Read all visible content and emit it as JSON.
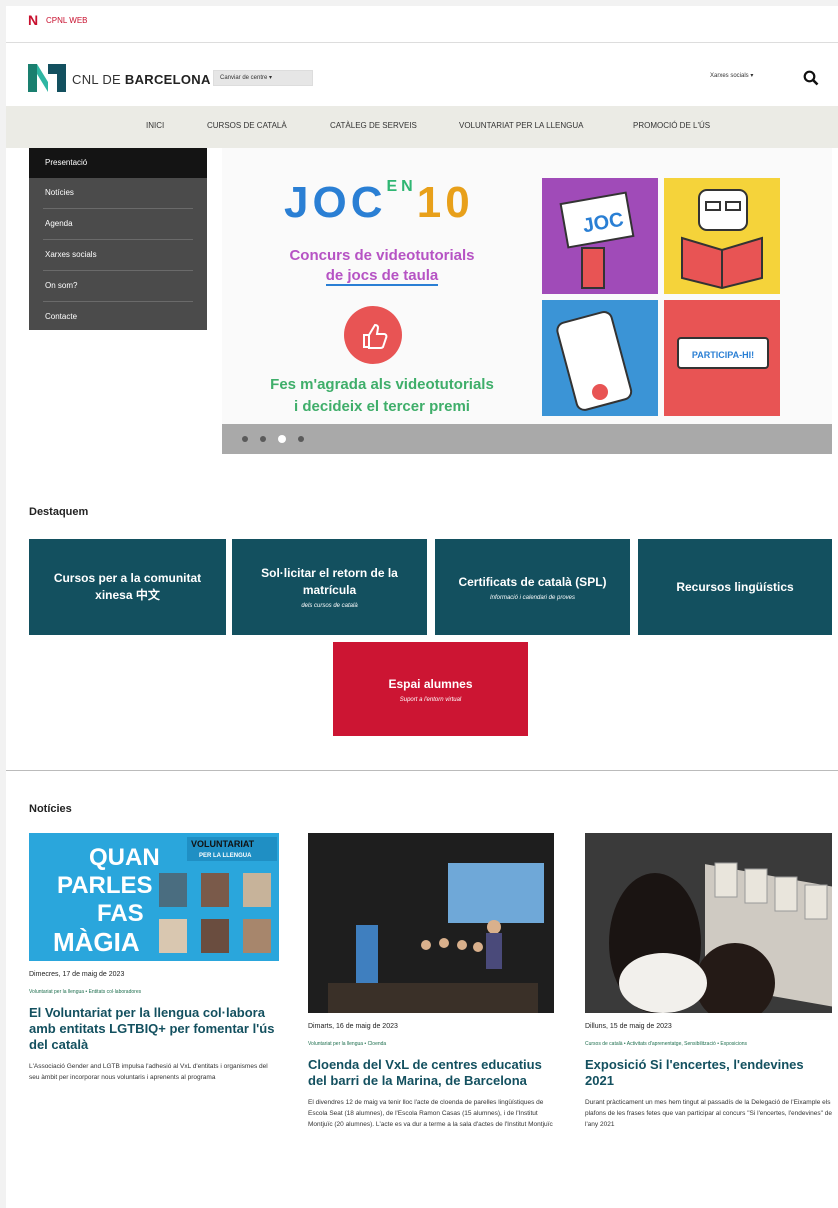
{
  "topbar": {
    "brand": "CPNL WEB"
  },
  "header": {
    "brand_prefix": "CNL DE ",
    "brand_city": "BARCELONA",
    "center_select": "Canviar de centre",
    "social_select": "Xarxes socials"
  },
  "nav": {
    "items": [
      "INICI",
      "CURSOS DE CATALÀ",
      "CATÀLEG DE SERVEIS",
      "VOLUNTARIAT PER LA LLENGUA",
      "PROMOCIÓ DE L'ÚS"
    ]
  },
  "sidemenu": {
    "items": [
      "Presentació",
      "Notícies",
      "Agenda",
      "Xarxes socials",
      "On som?",
      "Contacte"
    ]
  },
  "slider": {
    "title_left": "JOC",
    "title_en": "EN",
    "title_right": "10",
    "subtitle_line1": "Concurs de videotutorials",
    "subtitle_line2": "de jocs de taula",
    "cta_line1": "Fes m'agrada als videotutorials",
    "cta_line2": "i decideix el tercer premi",
    "tile_joc": "JOC",
    "tile_participa": "PARTICIPA-HI!",
    "active_dot": 2
  },
  "destaquem": {
    "title": "Destaquem",
    "cards": [
      {
        "title": "Cursos per a la comunitat xinesa 中文",
        "subtitle": ""
      },
      {
        "title": "Sol·licitar el retorn de la matrícula",
        "subtitle": "dels cursos de català"
      },
      {
        "title": "Certificats de català (SPL)",
        "subtitle": "Informació i calendari de proves"
      },
      {
        "title": "Recursos lingüístics",
        "subtitle": ""
      },
      {
        "title": "Espai alumnes",
        "subtitle": "Suport a l'entorn virtual"
      }
    ]
  },
  "noticies": {
    "title": "Notícies",
    "items": [
      {
        "image_text": {
          "line1": "QUAN",
          "line2": "PARLES",
          "line3": "FAS",
          "line4": "MÀGIA",
          "badge1": "VOLUNTARIAT",
          "badge2": "PER LA LLENGUA"
        },
        "date": "Dimecres, 17 de maig de 2023",
        "tags": "Voluntariat per la llengua • Entitats col·laboradores",
        "title": "El Voluntariat per la llengua col·labora amb entitats LGTBIQ+ per fomentar l'ús del català",
        "body": "L'Associació Gender and LGTB impulsa l'adhesió al VxL d'entitats i organismes del seu àmbit per incorporar nous voluntaris i aprenents al programa"
      },
      {
        "date": "Dimarts, 16 de maig de 2023",
        "tags": "Voluntariat per la llengua • Cloenda",
        "title": "Cloenda del VxL de centres educatius del barri de la Marina, de Barcelona",
        "body": "El divendres 12 de maig va tenir lloc l'acte de cloenda de parelles lingüístiques de Escola Seat (18 alumnes), de l'Escola Ramon Casas (15 alumnes), i de l'Institut Montjuïc (20 alumnes). L'acte es va dur a terme a la sala d'actes de l'Institut Montjuïc"
      },
      {
        "date": "Dilluns, 15 de maig de 2023",
        "tags": "Cursos de català • Activitats d'aprenentatge, Sensibilització • Exposicions",
        "title": "Exposició Si l'encertes, l'endevines 2021",
        "body": "Durant pràcticament un mes hem tingut al passadís de la Delegació de l'Eixample els plafons de les frases fetes que van participar al concurs \"Si l'encertes, l'endevines\" de l'any 2021"
      }
    ]
  },
  "colors": {
    "brand_red": "#c8102e",
    "teal": "#13505f",
    "nav_bg": "#ebebe5"
  }
}
